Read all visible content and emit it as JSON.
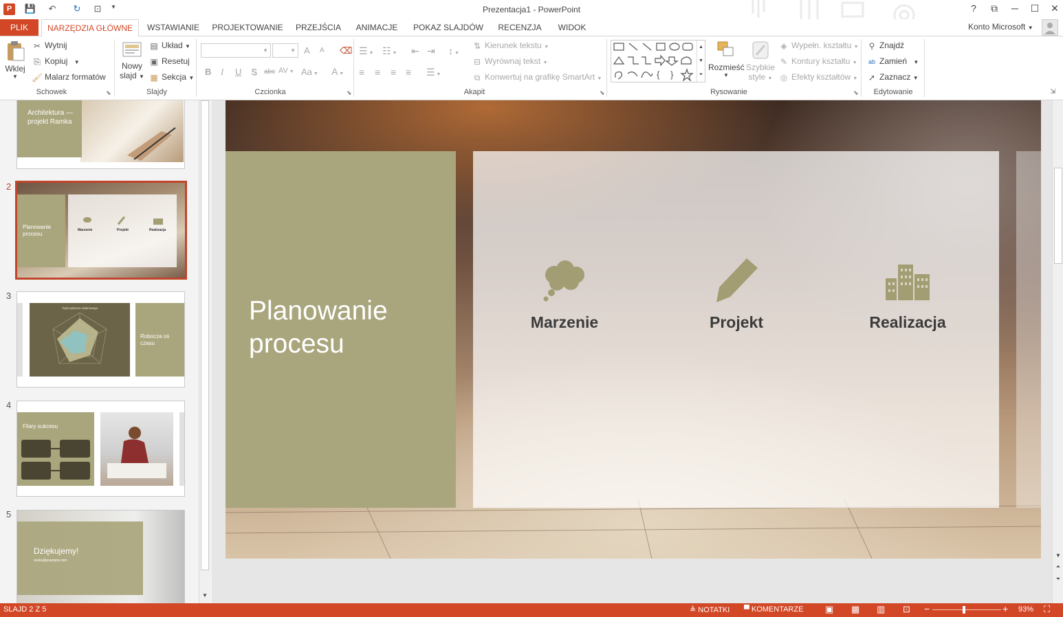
{
  "window": {
    "title": "Prezentacja1 - PowerPoint",
    "help": "?",
    "restore_ribbon": "⧉",
    "minimize": "─",
    "maximize": "☐",
    "close": "✕",
    "account": "Konto Microsoft"
  },
  "qat": {
    "app_icon": "P",
    "save": "💾",
    "undo": "↶",
    "redo": "↻",
    "present": "⊡",
    "customize": "▾"
  },
  "tabs": {
    "file": "PLIK",
    "home": "NARZĘDZIA GŁÓWNE",
    "insert": "WSTAWIANIE",
    "design": "PROJEKTOWANIE",
    "transitions": "PRZEJŚCIA",
    "animations": "ANIMACJE",
    "slideshow": "POKAZ SLAJDÓW",
    "review": "RECENZJA",
    "view": "WIDOK"
  },
  "ribbon": {
    "clipboard": {
      "paste": "Wklej",
      "cut": "Wytnij",
      "copy": "Kopiuj",
      "format_painter": "Malarz formatów",
      "label": "Schowek"
    },
    "slides": {
      "new_slide_1": "Nowy",
      "new_slide_2": "slajd",
      "layout": "Układ",
      "reset": "Resetuj",
      "section": "Sekcja",
      "label": "Slajdy"
    },
    "font": {
      "label": "Czcionka",
      "bold": "B",
      "italic": "I",
      "underline": "U",
      "shadow": "S",
      "strike": "abc",
      "spacing": "AV",
      "case": "Aa",
      "color": "A",
      "grow": "A",
      "shrink": "A"
    },
    "paragraph": {
      "label": "Akapit",
      "direction": "Kierunek tekstu",
      "align_text": "Wyrównaj tekst",
      "smartart": "Konwertuj na grafikę SmartArt"
    },
    "drawing": {
      "label": "Rysowanie",
      "arrange": "Rozmieść",
      "quick_styles_1": "Szybkie",
      "quick_styles_2": "style",
      "fill": "Wypełn. kształtu",
      "outline": "Kontury kształtu",
      "effects": "Efekty kształtów"
    },
    "editing": {
      "label": "Edytowanie",
      "find": "Znajdź",
      "replace": "Zamień",
      "select": "Zaznacz"
    }
  },
  "thumbnails": [
    {
      "num": "1",
      "text": "Architektura — projekt Ramka"
    },
    {
      "num": "2",
      "title": "Planowanie procesu",
      "labels": [
        "Marzenie",
        "Projekt",
        "Realizacja"
      ]
    },
    {
      "num": "3",
      "text": "Robocza oś czasu",
      "chart_title": "Tytuł wykresu radarowego"
    },
    {
      "num": "4",
      "text": "Filary sukcesu"
    },
    {
      "num": "5",
      "text": "Dziękujemy!",
      "email": "osoba@example.com"
    }
  ],
  "slide": {
    "title": "Planowanie procesu",
    "items": [
      {
        "label": "Marzenie",
        "icon": "thought-cloud-icon"
      },
      {
        "label": "Projekt",
        "icon": "pencil-icon"
      },
      {
        "label": "Realizacja",
        "icon": "buildings-icon"
      }
    ],
    "colors": {
      "panel": "#a9a57c",
      "accent": "#d24726",
      "icon": "#a39d74"
    }
  },
  "status": {
    "slide_info": "SLAJD 2 Z 5",
    "notes": "NOTATKI",
    "comments": "KOMENTARZE",
    "zoom": "93%",
    "zoom_minus": "−",
    "zoom_plus": "+"
  }
}
